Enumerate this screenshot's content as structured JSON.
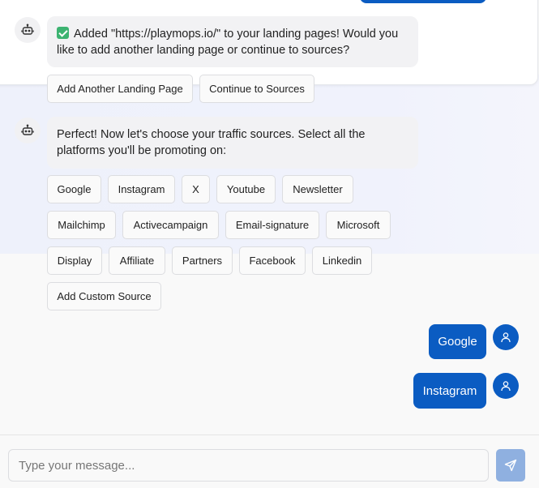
{
  "messages": {
    "landing_confirm": {
      "text": "Added \"https://playmops.io/\" to your landing pages! Would you like to add another landing page or continue to sources?",
      "actions": [
        "Add Another Landing Page",
        "Continue to Sources"
      ]
    },
    "traffic_prompt": {
      "text": "Perfect! Now let's choose your traffic sources. Select all the platforms you'll be promoting on:",
      "sources": [
        "Google",
        "Instagram",
        "X",
        "Youtube",
        "Newsletter",
        "Mailchimp",
        "Activecampaign",
        "Email-signature",
        "Microsoft",
        "Display",
        "Affiliate",
        "Partners",
        "Facebook",
        "Linkedin",
        "Add Custom Source"
      ]
    },
    "user_replies": [
      "Google",
      "Instagram"
    ]
  },
  "composer": {
    "placeholder": "Type your message..."
  },
  "icons": {
    "bot": "robot-icon",
    "user": "user-icon",
    "send": "send-icon",
    "check": "check-mark-icon"
  },
  "colors": {
    "accent": "#0b5cc2",
    "send_disabled": "#8fb0e0",
    "check_green": "#3cb371"
  }
}
